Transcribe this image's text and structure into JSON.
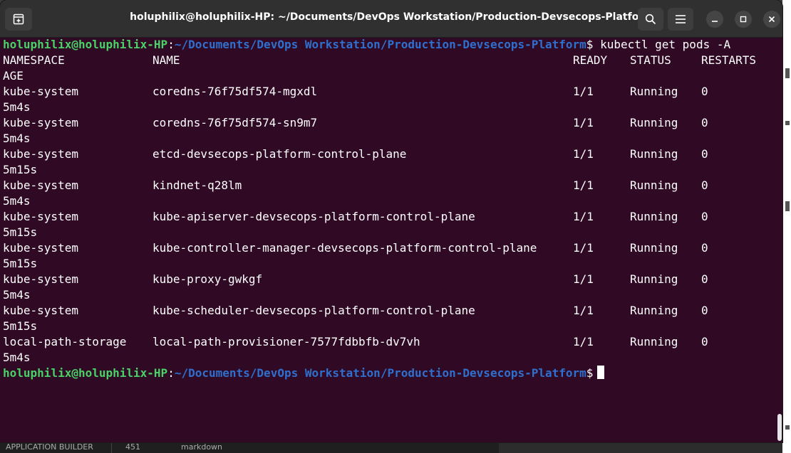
{
  "window": {
    "title": "holuphilix@holuphilix-HP: ~/Documents/DevOps Workstation/Production-Devsecops-Platform",
    "icons": {
      "new_tab": "new-tab-icon",
      "search": "search-icon",
      "menu": "hamburger-menu-icon",
      "minimize": "minimize-icon",
      "maximize": "maximize-icon",
      "close": "close-icon"
    }
  },
  "colors": {
    "terminal_bg": "#300a24",
    "prompt_user": "#4ad167",
    "prompt_path": "#2f6fce",
    "text": "#ffffff",
    "titlebar": "#303030"
  },
  "prompt": {
    "user": "holuphilix@holuphilix-HP",
    "sep": ":",
    "path": "~/Documents/DevOps Workstation/Production-Devsecops-Platform",
    "symbol": "$"
  },
  "command": "kubectl get pods -A",
  "table": {
    "headers": [
      "NAMESPACE",
      "NAME",
      "READY",
      "STATUS",
      "RESTARTS"
    ],
    "header_wrap": "AGE",
    "rows": [
      {
        "namespace": "kube-system",
        "name": "coredns-76f75df574-mgxdl",
        "ready": "1/1",
        "status": "Running",
        "restarts": "0",
        "age": "5m4s"
      },
      {
        "namespace": "kube-system",
        "name": "coredns-76f75df574-sn9m7",
        "ready": "1/1",
        "status": "Running",
        "restarts": "0",
        "age": "5m4s"
      },
      {
        "namespace": "kube-system",
        "name": "etcd-devsecops-platform-control-plane",
        "ready": "1/1",
        "status": "Running",
        "restarts": "0",
        "age": "5m15s"
      },
      {
        "namespace": "kube-system",
        "name": "kindnet-q28lm",
        "ready": "1/1",
        "status": "Running",
        "restarts": "0",
        "age": "5m4s"
      },
      {
        "namespace": "kube-system",
        "name": "kube-apiserver-devsecops-platform-control-plane",
        "ready": "1/1",
        "status": "Running",
        "restarts": "0",
        "age": "5m15s"
      },
      {
        "namespace": "kube-system",
        "name": "kube-controller-manager-devsecops-platform-control-plane",
        "ready": "1/1",
        "status": "Running",
        "restarts": "0",
        "age": "5m15s"
      },
      {
        "namespace": "kube-system",
        "name": "kube-proxy-gwkgf",
        "ready": "1/1",
        "status": "Running",
        "restarts": "0",
        "age": "5m4s"
      },
      {
        "namespace": "kube-system",
        "name": "kube-scheduler-devsecops-platform-control-plane",
        "ready": "1/1",
        "status": "Running",
        "restarts": "0",
        "age": "5m15s"
      },
      {
        "namespace": "local-path-storage",
        "name": "local-path-provisioner-7577fdbbfb-dv7vh",
        "ready": "1/1",
        "status": "Running",
        "restarts": "0",
        "age": "5m4s"
      }
    ]
  },
  "background": {
    "bottom_left": "APPLICATION BUILDER",
    "bottom_num": "451",
    "bottom_text": "markdown"
  }
}
